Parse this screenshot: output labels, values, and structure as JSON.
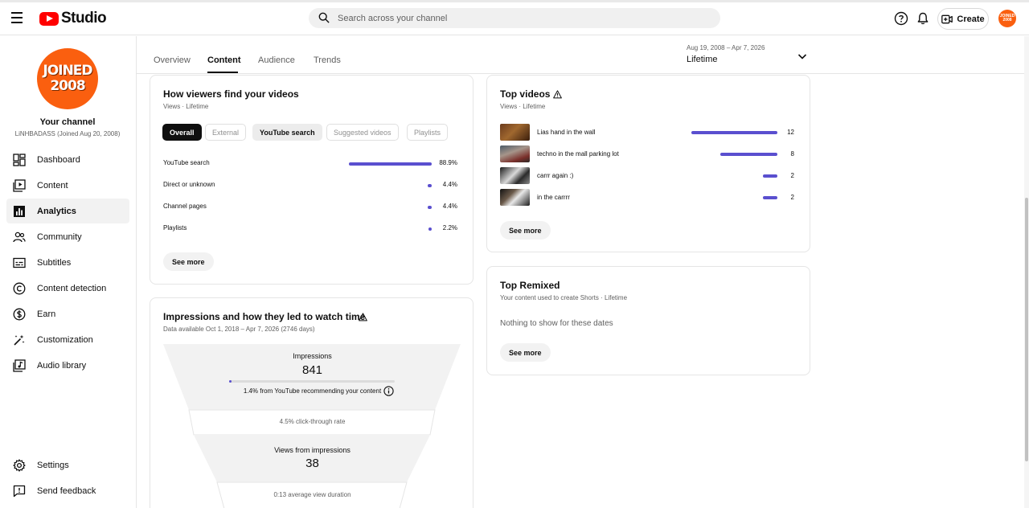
{
  "app": {
    "logo_text": "Studio",
    "brand_color": "#ff0000",
    "accent_color": "#5a4fcf"
  },
  "header": {
    "search_placeholder": "Search across your channel",
    "create_label": "Create",
    "avatar_text": "JOINED 2008"
  },
  "sidebar": {
    "avatar_text_line1": "JOINED",
    "avatar_text_line2": "2008",
    "channel_title": "Your channel",
    "channel_sub": "LiNHBADASS (Joined Aug 20, 2008)",
    "items": [
      {
        "label": "Dashboard",
        "icon": "dashboard-icon"
      },
      {
        "label": "Content",
        "icon": "content-icon"
      },
      {
        "label": "Analytics",
        "icon": "analytics-icon",
        "active": true
      },
      {
        "label": "Community",
        "icon": "community-icon"
      },
      {
        "label": "Subtitles",
        "icon": "subtitles-icon"
      },
      {
        "label": "Content detection",
        "icon": "copyright-icon"
      },
      {
        "label": "Earn",
        "icon": "dollar-icon"
      },
      {
        "label": "Customization",
        "icon": "magic-wand-icon"
      },
      {
        "label": "Audio library",
        "icon": "audio-library-icon"
      }
    ],
    "bottom_items": [
      {
        "label": "Settings",
        "icon": "gear-icon"
      },
      {
        "label": "Send feedback",
        "icon": "feedback-icon"
      }
    ]
  },
  "tabs": {
    "items": [
      "Overview",
      "Content",
      "Audience",
      "Trends"
    ],
    "active": "Content",
    "date_range": "Aug 19, 2008 – Apr 7, 2026",
    "date_label": "Lifetime"
  },
  "traffic_card": {
    "title": "How viewers find your videos",
    "subtitle": "Views · Lifetime",
    "chips": [
      {
        "label": "Overall",
        "state": "selected"
      },
      {
        "label": "External",
        "state": "disabled"
      },
      {
        "label": "YouTube search",
        "state": "available"
      },
      {
        "label": "Suggested videos",
        "state": "disabled"
      },
      {
        "label": "Playlists",
        "state": "disabled"
      }
    ],
    "rows": [
      {
        "label": "YouTube search",
        "value": "88.9%",
        "fraction": 0.889
      },
      {
        "label": "Direct or unknown",
        "value": "4.4%",
        "fraction": 0.044
      },
      {
        "label": "Channel pages",
        "value": "4.4%",
        "fraction": 0.044
      },
      {
        "label": "Playlists",
        "value": "2.2%",
        "fraction": 0.022
      }
    ],
    "see_more": "See more"
  },
  "impressions_card": {
    "title": "Impressions and how they led to watch time",
    "subtitle": "Data available Oct 1, 2018 – Apr 7, 2026 (2746 days)",
    "impressions_label": "Impressions",
    "impressions_value": "841",
    "impressions_progress": 0.014,
    "recommend_text": "1.4% from YouTube recommending your content",
    "ctr_text": "4.5% click-through rate",
    "views_label": "Views from impressions",
    "views_value": "38",
    "avd_text": "0:13 average view duration"
  },
  "top_videos_card": {
    "title": "Top videos",
    "subtitle": "Views · Lifetime",
    "videos": [
      {
        "title": "Lias hand in the wall",
        "value": "12",
        "views": 12
      },
      {
        "title": "techno in the mall parking lot",
        "value": "8",
        "views": 8
      },
      {
        "title": "carrr again :)",
        "value": "2",
        "views": 2
      },
      {
        "title": "in the carrrr",
        "value": "2",
        "views": 2
      }
    ],
    "see_more": "See more"
  },
  "remix_card": {
    "title": "Top Remixed",
    "subtitle": "Your content used to create Shorts · Lifetime",
    "empty_text": "Nothing to show for these dates",
    "see_more": "See more"
  }
}
